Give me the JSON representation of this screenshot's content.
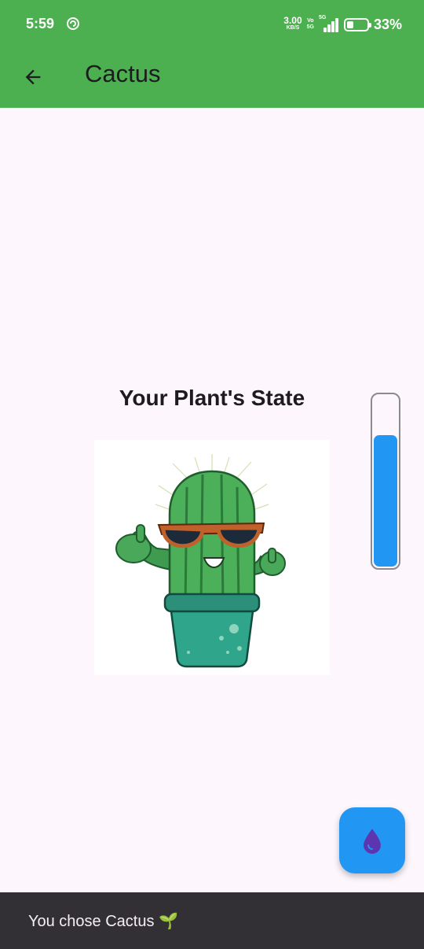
{
  "status_bar": {
    "time": "5:59",
    "net_speed_value": "3.00",
    "net_speed_unit": "KB/S",
    "volte_top": "Vo",
    "volte_bottom": "5G",
    "signal_tag": "5G",
    "battery_percent": "33%",
    "battery_level": 0.33
  },
  "app_bar": {
    "back_icon": "arrow-left-icon",
    "title": "Cactus"
  },
  "main": {
    "state_title": "Your Plant's State",
    "plant_image": "cactus-with-sunglasses-thumbs-up",
    "water_level": 0.77,
    "water_color": "#2196f3"
  },
  "fab": {
    "icon": "water-drop-icon",
    "color": "#2196f3"
  },
  "snackbar": {
    "message": "You chose Cactus 🌱"
  },
  "colors": {
    "primary": "#4caf50",
    "background": "#fdf7fd",
    "snackbar": "#322f35"
  }
}
